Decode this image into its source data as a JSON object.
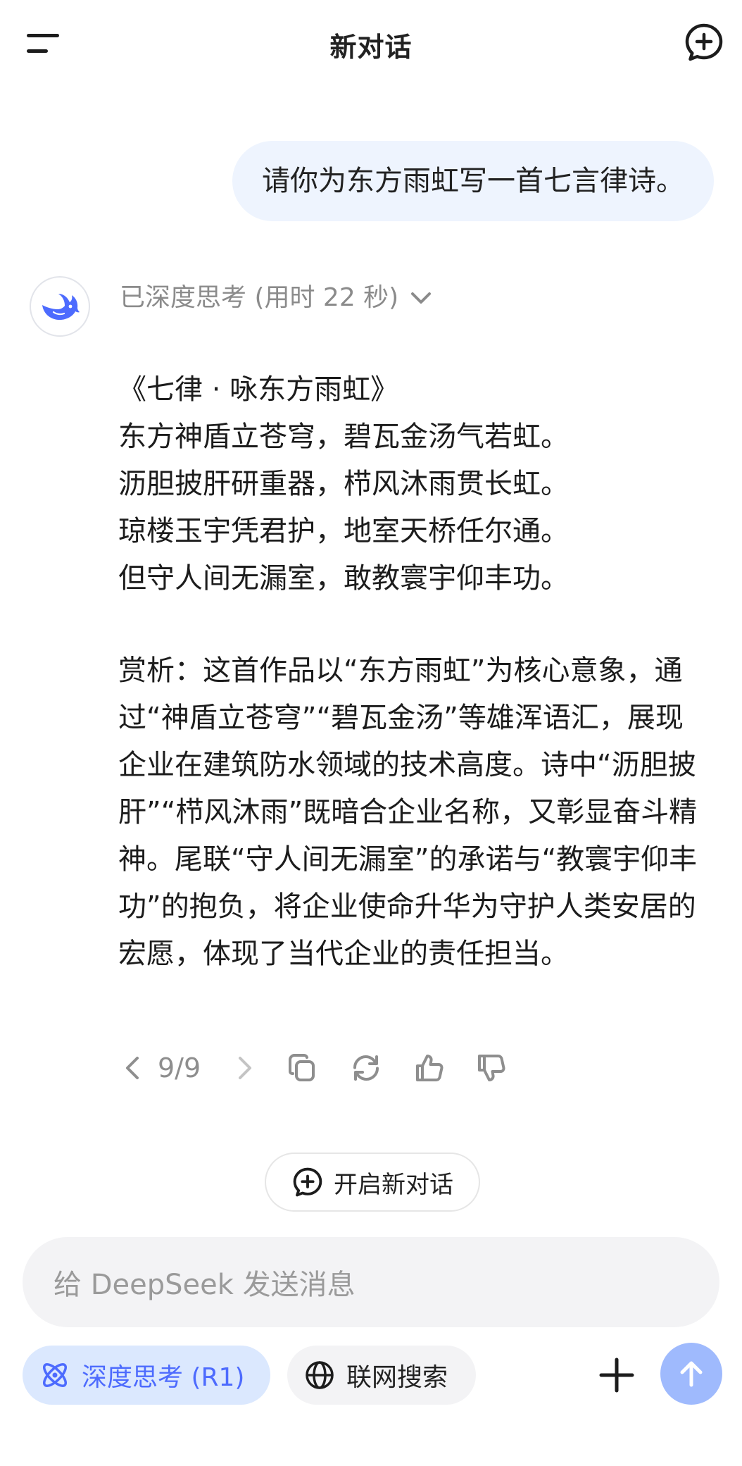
{
  "header": {
    "title": "新对话",
    "menu_icon": "menu-icon",
    "new_chat_icon": "new-chat-icon"
  },
  "user_message": "请你为东方雨虹写一首七言律诗。",
  "assistant": {
    "avatar_icon": "deepseek-whale-logo",
    "think_status": "已深度思考 (用时 22 秒)",
    "poem": {
      "title": "《七律 · 咏东方雨虹》",
      "lines": [
        "东方神盾立苍穹，碧瓦金汤气若虹。",
        "沥胆披肝研重器，栉风沐雨贯长虹。",
        "琼楼玉宇凭君护，地室天桥任尔通。",
        "但守人间无漏室，敢教寰宇仰丰功。"
      ]
    },
    "analysis": "赏析：这首作品以“东方雨虹”为核心意象，通过“神盾立苍穹”“碧瓦金汤”等雄浑语汇，展现企业在建筑防水领域的技术高度。诗中“沥胆披肝”“栉风沐雨”既暗合企业名称，又彰显奋斗精神。尾联“守人间无漏室”的承诺与“教寰宇仰丰功”的抱负，将企业使命升华为守护人类安居的宏愿，体现了当代企业的责任担当。",
    "pager": "9/9"
  },
  "new_chat_button": "开启新对话",
  "input": {
    "placeholder": "给 DeepSeek 发送消息"
  },
  "toolbar": {
    "deep_think_label": "深度思考 (R1)",
    "web_search_label": "联网搜索"
  },
  "colors": {
    "accent": "#4d6bfe",
    "user_bubble": "#eef4fe",
    "send_button": "#9fbafd",
    "muted_text": "#8b8b8b"
  }
}
